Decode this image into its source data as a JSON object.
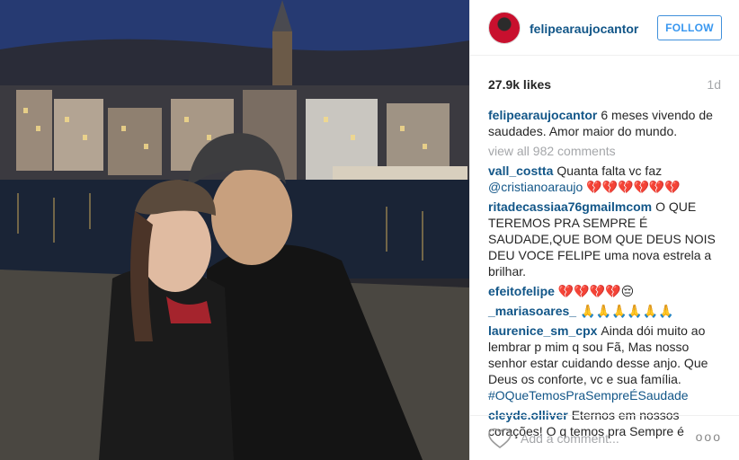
{
  "post": {
    "username": "felipearaujocantor",
    "follow_label": "FOLLOW",
    "likes": "27.9k likes",
    "age": "1d",
    "caption_user": "felipearaujocantor",
    "caption_text": "6 meses vivendo de saudades. Amor maior do mundo.",
    "view_all": "view all 982 comments",
    "comments": [
      {
        "user": "vall_costta",
        "text": "Quanta falta vc faz",
        "tag": "@cristianoaraujo",
        "suffix": " 💔💔💔💔💔💔"
      },
      {
        "user": "ritadecassiaa76gmailmcom",
        "text": "O QUE TEREMOS PRA SEMPRE É SAUDADE,QUE BOM QUE DEUS NOIS DEU VOCE FELIPE uma nova estrela a brilhar.",
        "tag": "",
        "suffix": ""
      },
      {
        "user": "efeitofelipe",
        "text": "💔💔💔💔😔",
        "tag": "",
        "suffix": ""
      },
      {
        "user": "_mariasoares_",
        "text": "🙏🙏🙏🙏🙏🙏",
        "tag": "",
        "suffix": ""
      },
      {
        "user": "laurenice_sm_cpx",
        "text": "Ainda dói muito ao lembrar p mim q sou Fã, Mas nosso senhor estar cuidando desse anjo. Que Deus os conforte, vc e sua família.",
        "tag": "#OQueTemosPraSempreÉSaudade",
        "suffix": ""
      },
      {
        "user": "cleyde.olliver",
        "text": "Eternos em nossos corações! O q temos pra Sempre é",
        "tag": "",
        "suffix": ""
      }
    ],
    "add_comment_placeholder": "Add a comment...",
    "more_label": "ooo",
    "heart_icon": "heart-icon"
  }
}
